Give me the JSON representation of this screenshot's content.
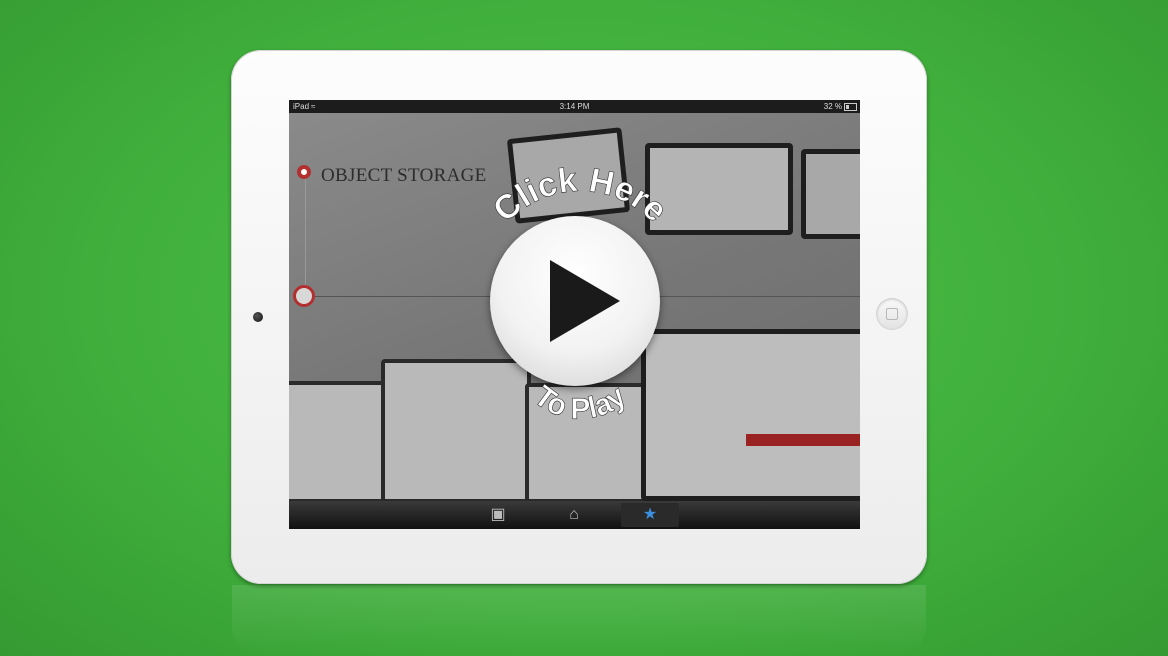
{
  "device": {
    "name": "iPad"
  },
  "statusbar": {
    "carrier": "iPad",
    "time": "3:14 PM",
    "battery": "32 %"
  },
  "slide": {
    "title": "OBJECT STORAGE"
  },
  "overlay": {
    "top_text": "Click Here",
    "bottom_text": "To Play"
  },
  "toolbar": {
    "items": [
      {
        "icon": "camera-icon",
        "glyph": "📷"
      },
      {
        "icon": "home-icon",
        "glyph": "⌂"
      },
      {
        "icon": "star-icon",
        "glyph": "★"
      }
    ]
  },
  "colors": {
    "background": "#45b840",
    "accent": "#b23030",
    "star": "#3b8fe0"
  }
}
